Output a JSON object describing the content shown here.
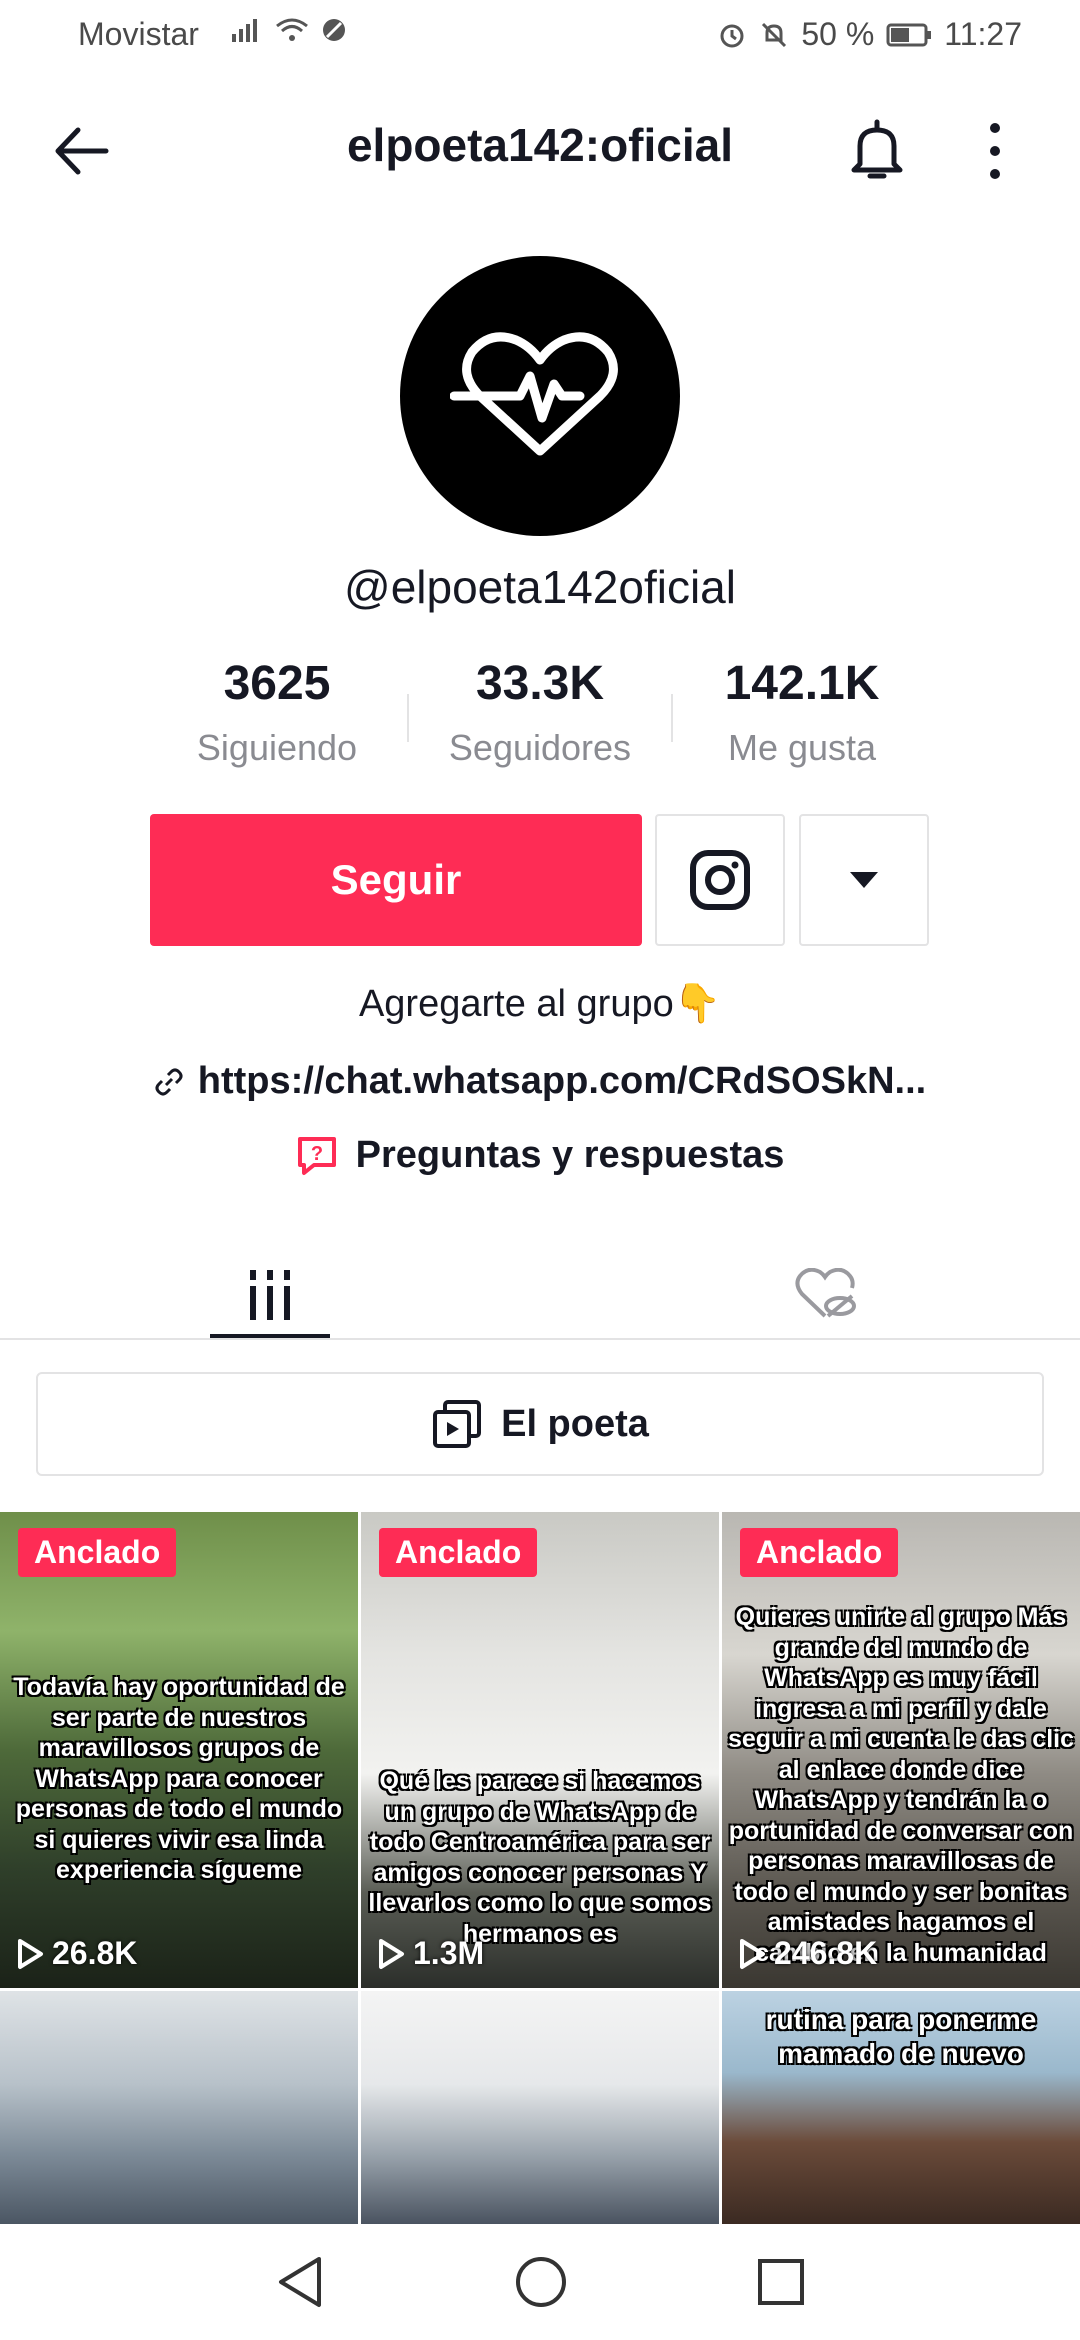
{
  "status_bar": {
    "carrier": "Movistar",
    "battery": "50 %",
    "time": "11:27"
  },
  "header": {
    "title": "elpoeta142:oficial"
  },
  "profile": {
    "username": "@elpoeta142oficial",
    "stats": [
      {
        "value": "3625",
        "label": "Siguiendo"
      },
      {
        "value": "33.3K",
        "label": "Seguidores"
      },
      {
        "value": "142.1K",
        "label": "Me gusta"
      }
    ],
    "follow_label": "Seguir",
    "bio": "Agregarte al grupo👇",
    "link": "https://chat.whatsapp.com/CRdSOSkN...",
    "qa_label": "Preguntas y respuestas"
  },
  "playlist": {
    "label": "El poeta"
  },
  "videos": [
    {
      "pinned": "Anclado",
      "views": "26.8K",
      "caption": "Todavía hay oportunidad de ser parte de nuestros maravillosos grupos de WhatsApp para conocer personas de todo el mundo si quieres vivir esa linda experiencia sígueme"
    },
    {
      "pinned": "Anclado",
      "views": "1.3M",
      "caption": "Qué les parece si hacemos un grupo de WhatsApp de todo Centroamérica para ser amigos conocer personas Y llevarlos como lo que somos hermanos es"
    },
    {
      "pinned": "Anclado",
      "views": "246.8K",
      "caption": "Quieres unirte al grupo Más grande del mundo de WhatsApp es muy fácil ingresa a mi perfil y dale seguir a mi cuenta le das clic al enlace donde dice WhatsApp y tendrán la o portunidad de conversar con personas maravillosas de todo el mundo y ser bonitas amistades hagamos el cambio en la humanidad"
    },
    {
      "caption": ""
    },
    {
      "caption": ""
    },
    {
      "caption": "rutina para ponerme mamado de nuevo"
    }
  ],
  "colors": {
    "accent": "#fe2c55",
    "text": "#161823",
    "muted": "#8a8b91",
    "border": "#e3e3e4"
  }
}
